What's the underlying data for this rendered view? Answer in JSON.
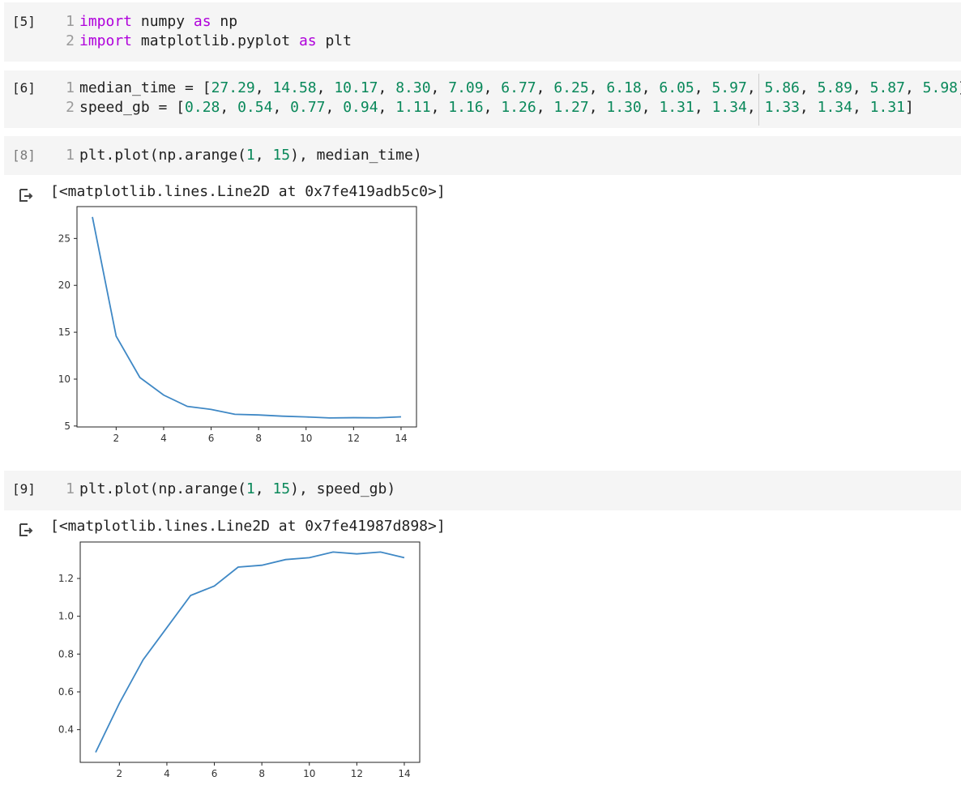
{
  "cells": [
    {
      "prompt": "[5]",
      "lines": [
        {
          "num": "1",
          "tokens": [
            [
              "kw",
              "import"
            ],
            [
              "plain",
              " numpy "
            ],
            [
              "kw",
              "as"
            ],
            [
              "plain",
              " np"
            ]
          ]
        },
        {
          "num": "2",
          "tokens": [
            [
              "kw",
              "import"
            ],
            [
              "plain",
              " matplotlib.pyplot "
            ],
            [
              "kw",
              "as"
            ],
            [
              "plain",
              " plt"
            ]
          ]
        }
      ]
    },
    {
      "prompt": "[6]",
      "lines": [
        {
          "num": "1",
          "tokens": [
            [
              "plain",
              "median_time = ["
            ],
            [
              "num",
              "27.29"
            ],
            [
              "plain",
              ", "
            ],
            [
              "num",
              "14.58"
            ],
            [
              "plain",
              ", "
            ],
            [
              "num",
              "10.17"
            ],
            [
              "plain",
              ", "
            ],
            [
              "num",
              "8.30"
            ],
            [
              "plain",
              ", "
            ],
            [
              "num",
              "7.09"
            ],
            [
              "plain",
              ", "
            ],
            [
              "num",
              "6.77"
            ],
            [
              "plain",
              ", "
            ],
            [
              "num",
              "6.25"
            ],
            [
              "plain",
              ", "
            ],
            [
              "num",
              "6.18"
            ],
            [
              "plain",
              ", "
            ],
            [
              "num",
              "6.05"
            ],
            [
              "plain",
              ", "
            ],
            [
              "num",
              "5.97"
            ],
            [
              "plain",
              ", "
            ],
            [
              "num",
              "5.86"
            ],
            [
              "plain",
              ", "
            ],
            [
              "num",
              "5.89"
            ],
            [
              "plain",
              ", "
            ],
            [
              "num",
              "5.87"
            ],
            [
              "plain",
              ", "
            ],
            [
              "num",
              "5.98"
            ],
            [
              "plain",
              "]"
            ]
          ]
        },
        {
          "num": "2",
          "tokens": [
            [
              "plain",
              "speed_gb = ["
            ],
            [
              "num",
              "0.28"
            ],
            [
              "plain",
              ", "
            ],
            [
              "num",
              "0.54"
            ],
            [
              "plain",
              ", "
            ],
            [
              "num",
              "0.77"
            ],
            [
              "plain",
              ", "
            ],
            [
              "num",
              "0.94"
            ],
            [
              "plain",
              ", "
            ],
            [
              "num",
              "1.11"
            ],
            [
              "plain",
              ", "
            ],
            [
              "num",
              "1.16"
            ],
            [
              "plain",
              ", "
            ],
            [
              "num",
              "1.26"
            ],
            [
              "plain",
              ", "
            ],
            [
              "num",
              "1.27"
            ],
            [
              "plain",
              ", "
            ],
            [
              "num",
              "1.30"
            ],
            [
              "plain",
              ", "
            ],
            [
              "num",
              "1.31"
            ],
            [
              "plain",
              ", "
            ],
            [
              "num",
              "1.34"
            ],
            [
              "plain",
              ", "
            ],
            [
              "num",
              "1.33"
            ],
            [
              "plain",
              ", "
            ],
            [
              "num",
              "1.34"
            ],
            [
              "plain",
              ", "
            ],
            [
              "num",
              "1.31"
            ],
            [
              "plain",
              "]"
            ]
          ]
        }
      ]
    },
    {
      "prompt": "[8]",
      "lines": [
        {
          "num": "1",
          "tokens": [
            [
              "plain",
              "plt.plot(np.arange("
            ],
            [
              "num",
              "1"
            ],
            [
              "plain",
              ", "
            ],
            [
              "num",
              "15"
            ],
            [
              "plain",
              "), median_time)"
            ]
          ]
        }
      ]
    },
    {
      "prompt": "[9]",
      "lines": [
        {
          "num": "1",
          "tokens": [
            [
              "plain",
              "plt.plot(np.arange("
            ],
            [
              "num",
              "1"
            ],
            [
              "plain",
              ", "
            ],
            [
              "num",
              "15"
            ],
            [
              "plain",
              "), speed_gb)"
            ]
          ]
        }
      ]
    }
  ],
  "outputs": [
    {
      "text": "[<matplotlib.lines.Line2D at 0x7fe419adb5c0>]",
      "icon": "output-redirect-icon"
    },
    {
      "text": "[<matplotlib.lines.Line2D at 0x7fe41987d898>]",
      "icon": "output-redirect-icon"
    }
  ],
  "colors": {
    "line": "#3f88c5",
    "cell_bg": "#f5f5f5",
    "keyword": "#af00db",
    "number": "#09885a"
  },
  "chart_data": [
    {
      "type": "line",
      "x": [
        1,
        2,
        3,
        4,
        5,
        6,
        7,
        8,
        9,
        10,
        11,
        12,
        13,
        14
      ],
      "series": [
        {
          "values": [
            27.29,
            14.58,
            10.17,
            8.3,
            7.09,
            6.77,
            6.25,
            6.18,
            6.05,
            5.97,
            5.86,
            5.89,
            5.87,
            5.98
          ]
        }
      ],
      "xticks": [
        2,
        4,
        6,
        8,
        10,
        12,
        14
      ],
      "yticks": [
        5,
        10,
        15,
        20,
        25
      ],
      "xlim": [
        0.35,
        14.65
      ],
      "ylim": [
        4.9,
        28.4
      ],
      "title": "",
      "xlabel": "",
      "ylabel": "",
      "grid": false
    },
    {
      "type": "line",
      "x": [
        1,
        2,
        3,
        4,
        5,
        6,
        7,
        8,
        9,
        10,
        11,
        12,
        13,
        14
      ],
      "series": [
        {
          "values": [
            0.28,
            0.54,
            0.77,
            0.94,
            1.11,
            1.16,
            1.26,
            1.27,
            1.3,
            1.31,
            1.34,
            1.33,
            1.34,
            1.31
          ]
        }
      ],
      "xticks": [
        2,
        4,
        6,
        8,
        10,
        12,
        14
      ],
      "yticks": [
        0.4,
        0.6,
        0.8,
        1.0,
        1.2
      ],
      "ytick_labels": [
        "0.4",
        "0.6",
        "0.8",
        "1.0",
        "1.2"
      ],
      "xlim": [
        0.35,
        14.65
      ],
      "ylim": [
        0.227,
        1.393
      ],
      "title": "",
      "xlabel": "",
      "ylabel": "",
      "grid": false
    }
  ]
}
